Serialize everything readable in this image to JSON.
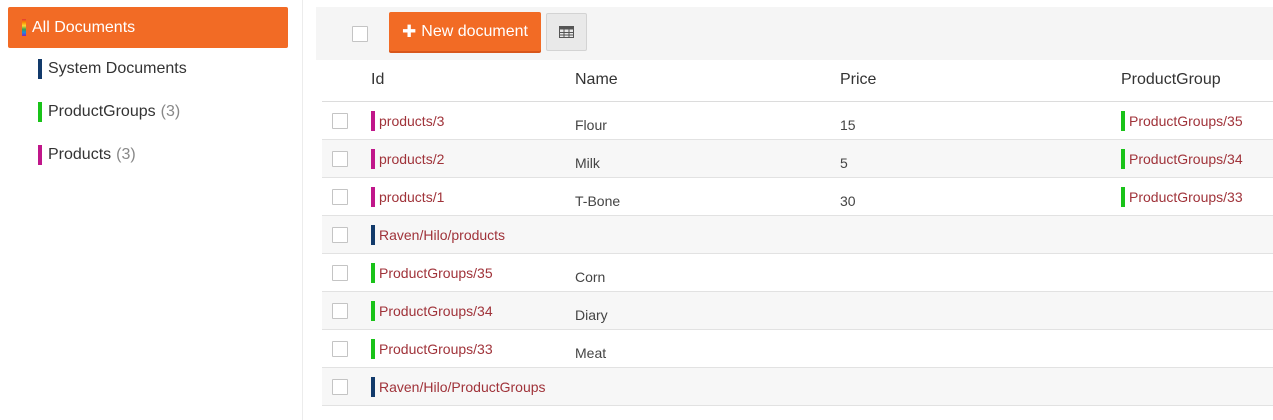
{
  "colors": {
    "accent": "#f26b25",
    "system": "#123a6b",
    "productgroups": "#19c319",
    "products": "#c0168a",
    "link": "#a0333a"
  },
  "sidebar": {
    "all_documents": "All Documents",
    "collections": [
      {
        "label": "System Documents",
        "count": "",
        "color": "#123a6b"
      },
      {
        "label": "ProductGroups",
        "count": "(3)",
        "color": "#19c319"
      },
      {
        "label": "Products",
        "count": "(3)",
        "color": "#c0168a"
      }
    ]
  },
  "toolbar": {
    "new_document": "New document",
    "plus_icon": "plus-icon",
    "grid_icon": "table-icon"
  },
  "table": {
    "headers": {
      "id": "Id",
      "name": "Name",
      "price": "Price",
      "productgroup": "ProductGroup"
    },
    "rows": [
      {
        "id": "products/3",
        "id_color": "#c0168a",
        "name": "Flour",
        "price": "15",
        "productgroup": "ProductGroups/35"
      },
      {
        "id": "products/2",
        "id_color": "#c0168a",
        "name": "Milk",
        "price": "5",
        "productgroup": "ProductGroups/34"
      },
      {
        "id": "products/1",
        "id_color": "#c0168a",
        "name": "T-Bone",
        "price": "30",
        "productgroup": "ProductGroups/33"
      },
      {
        "id": "Raven/Hilo/products",
        "id_color": "#123a6b",
        "name": "",
        "price": "",
        "productgroup": ""
      },
      {
        "id": "ProductGroups/35",
        "id_color": "#19c319",
        "name": "Corn",
        "price": "",
        "productgroup": ""
      },
      {
        "id": "ProductGroups/34",
        "id_color": "#19c319",
        "name": "Diary",
        "price": "",
        "productgroup": ""
      },
      {
        "id": "ProductGroups/33",
        "id_color": "#19c319",
        "name": "Meat",
        "price": "",
        "productgroup": ""
      },
      {
        "id": "Raven/Hilo/ProductGroups",
        "id_color": "#123a6b",
        "name": "",
        "price": "",
        "productgroup": ""
      }
    ]
  }
}
